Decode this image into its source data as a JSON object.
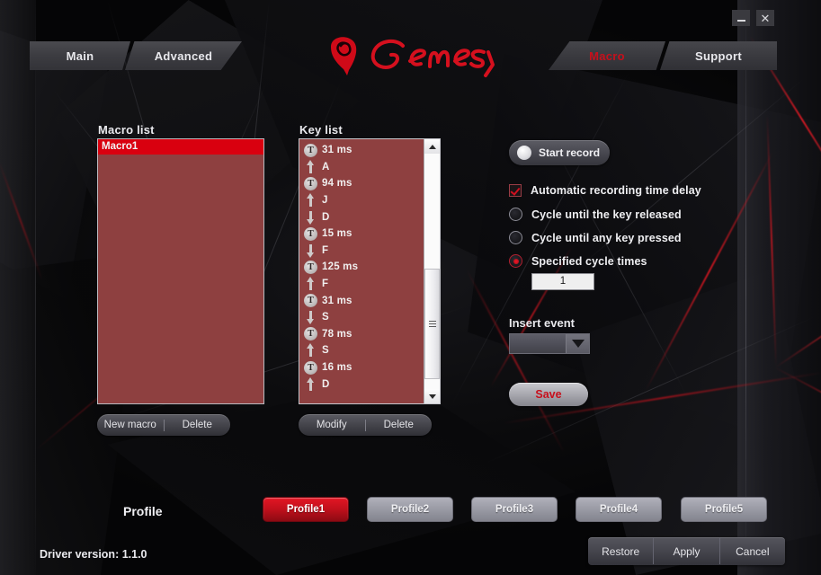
{
  "window": {
    "minimize_label": "—",
    "close_label": "✕"
  },
  "brand": {
    "name": "Genesis"
  },
  "nav": {
    "left_tabs": [
      {
        "label": "Main",
        "active": false
      },
      {
        "label": "Advanced",
        "active": false
      }
    ],
    "right_tabs": [
      {
        "label": "Macro",
        "active": true
      },
      {
        "label": "Support",
        "active": false
      }
    ]
  },
  "macro_panel": {
    "title": "Macro list",
    "items": [
      {
        "label": "Macro1",
        "selected": true
      }
    ],
    "buttons": [
      {
        "label": "New macro"
      },
      {
        "label": "Delete"
      }
    ]
  },
  "key_panel": {
    "title": "Key list",
    "items": [
      {
        "icon": "timer-icon",
        "label": "31 ms"
      },
      {
        "icon": "arrow-up-icon",
        "label": "A"
      },
      {
        "icon": "timer-icon",
        "label": "94 ms"
      },
      {
        "icon": "arrow-up-icon",
        "label": "J"
      },
      {
        "icon": "arrow-down-icon",
        "label": "D"
      },
      {
        "icon": "timer-icon",
        "label": "15 ms"
      },
      {
        "icon": "arrow-down-icon",
        "label": "F"
      },
      {
        "icon": "timer-icon",
        "label": "125 ms"
      },
      {
        "icon": "arrow-up-icon",
        "label": "F"
      },
      {
        "icon": "timer-icon",
        "label": "31 ms"
      },
      {
        "icon": "arrow-down-icon",
        "label": "S"
      },
      {
        "icon": "timer-icon",
        "label": "78 ms"
      },
      {
        "icon": "arrow-up-icon",
        "label": "S"
      },
      {
        "icon": "timer-icon",
        "label": "16 ms"
      },
      {
        "icon": "arrow-up-icon",
        "label": "D"
      }
    ],
    "buttons": [
      {
        "label": "Modify"
      },
      {
        "label": "Delete"
      }
    ]
  },
  "record_panel": {
    "start_record_label": "Start record",
    "options": [
      {
        "type": "checkbox",
        "label": "Automatic recording time delay",
        "checked": true
      },
      {
        "type": "radio",
        "label": "Cycle until the key released",
        "checked": false
      },
      {
        "type": "radio",
        "label": "Cycle until any key pressed",
        "checked": false
      },
      {
        "type": "radio",
        "label": "Specified cycle times",
        "checked": true
      }
    ],
    "cycle_times_value": "1",
    "insert_event_label": "Insert event",
    "insert_event_selected": "",
    "save_label": "Save"
  },
  "profile_bar": {
    "label": "Profile",
    "profiles": [
      {
        "label": "Profile1",
        "active": true
      },
      {
        "label": "Profile2",
        "active": false
      },
      {
        "label": "Profile3",
        "active": false
      },
      {
        "label": "Profile4",
        "active": false
      },
      {
        "label": "Profile5",
        "active": false
      }
    ]
  },
  "footer": {
    "driver_version_text": "Driver version:  1.1.0",
    "actions": [
      {
        "label": "Restore"
      },
      {
        "label": "Apply"
      },
      {
        "label": "Cancel"
      }
    ]
  },
  "colors": {
    "accent_red": "#c8101c",
    "bright_red": "#d9000f",
    "list_bg": "#8e4040",
    "panel_dark": "#0a0a0b",
    "text_light": "#eeeef1"
  }
}
